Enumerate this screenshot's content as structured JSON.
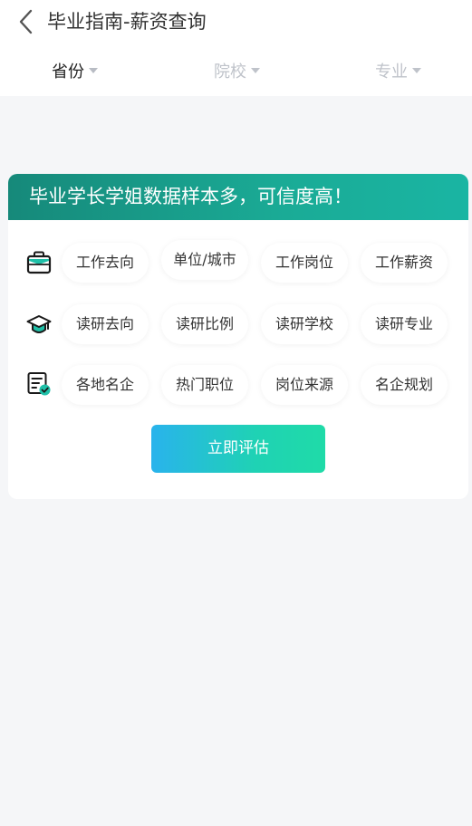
{
  "header": {
    "title": "毕业指南-薪资查询",
    "back_icon": "chevron-left-icon"
  },
  "filters": [
    {
      "label": "省份",
      "active": true
    },
    {
      "label": "院校",
      "active": false
    },
    {
      "label": "专业",
      "active": false
    }
  ],
  "card": {
    "banner": "毕业学长学姐数据样本多，可信度高！",
    "rows": [
      {
        "icon": "briefcase-icon",
        "items": [
          "工作去向",
          "单位/城市",
          "工作岗位",
          "工作薪资"
        ]
      },
      {
        "icon": "graduation-cap-icon",
        "items": [
          "读研去向",
          "读研比例",
          "读研学校",
          "读研专业"
        ]
      },
      {
        "icon": "document-check-icon",
        "items": [
          "各地名企",
          "热门职位",
          "岗位来源",
          "名企规划"
        ]
      }
    ],
    "cta": "立即评估"
  },
  "colors": {
    "banner": "#1aab96",
    "accent_teal": "#1ab5a3",
    "cta_start": "#29b3ec",
    "cta_end": "#1fdba8",
    "background": "#f5f6f8"
  }
}
